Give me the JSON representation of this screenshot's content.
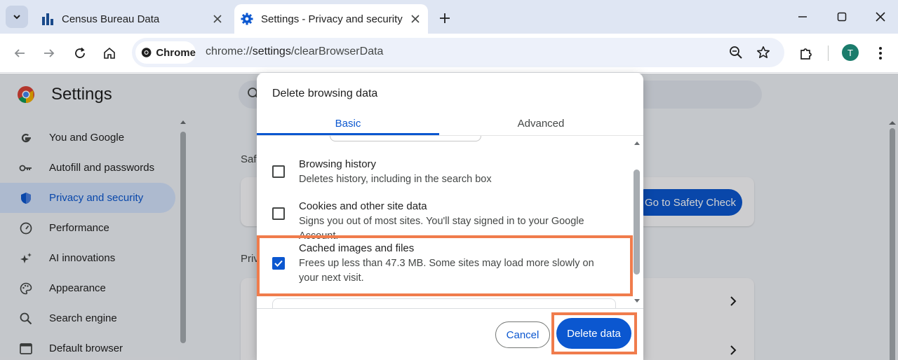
{
  "tabs": [
    {
      "title": "Census Bureau Data",
      "icon": "bar-chart-icon",
      "active": false
    },
    {
      "title": "Settings - Privacy and security",
      "icon": "gear-icon",
      "active": true
    }
  ],
  "omnibox": {
    "chip_label": "Chrome",
    "url_prefix": "chrome://",
    "url_host": "settings",
    "url_path": "/clearBrowserData"
  },
  "profile": {
    "initial": "T",
    "color": "#1b7c6c"
  },
  "settings": {
    "title": "Settings",
    "nav": [
      {
        "label": "You and Google",
        "icon": "google-icon"
      },
      {
        "label": "Autofill and passwords",
        "icon": "key-icon"
      },
      {
        "label": "Privacy and security",
        "icon": "shield-icon",
        "active": true
      },
      {
        "label": "Performance",
        "icon": "speedometer-icon"
      },
      {
        "label": "AI innovations",
        "icon": "sparkle-icon"
      },
      {
        "label": "Appearance",
        "icon": "palette-icon"
      },
      {
        "label": "Search engine",
        "icon": "search-icon"
      },
      {
        "label": "Default browser",
        "icon": "browser-window-icon"
      }
    ],
    "section_safety_fragment": "Safe",
    "section_privacy_fragment": "Priv",
    "safety_check_button": "Go to Safety Check"
  },
  "dialog": {
    "title": "Delete browsing data",
    "tabs": {
      "basic": "Basic",
      "advanced": "Advanced"
    },
    "options": [
      {
        "title": "Browsing history",
        "desc": "Deletes history, including in the search box",
        "checked": false
      },
      {
        "title": "Cookies and other site data",
        "desc": "Signs you out of most sites. You'll stay signed in to your Google Account.",
        "checked": false
      },
      {
        "title": "Cached images and files",
        "desc": "Frees up less than 47.3 MB. Some sites may load more slowly on your next visit.",
        "checked": true
      }
    ],
    "cancel_label": "Cancel",
    "delete_label": "Delete data"
  },
  "colors": {
    "accent": "#0b57d0",
    "highlight": "#f07c4c"
  }
}
